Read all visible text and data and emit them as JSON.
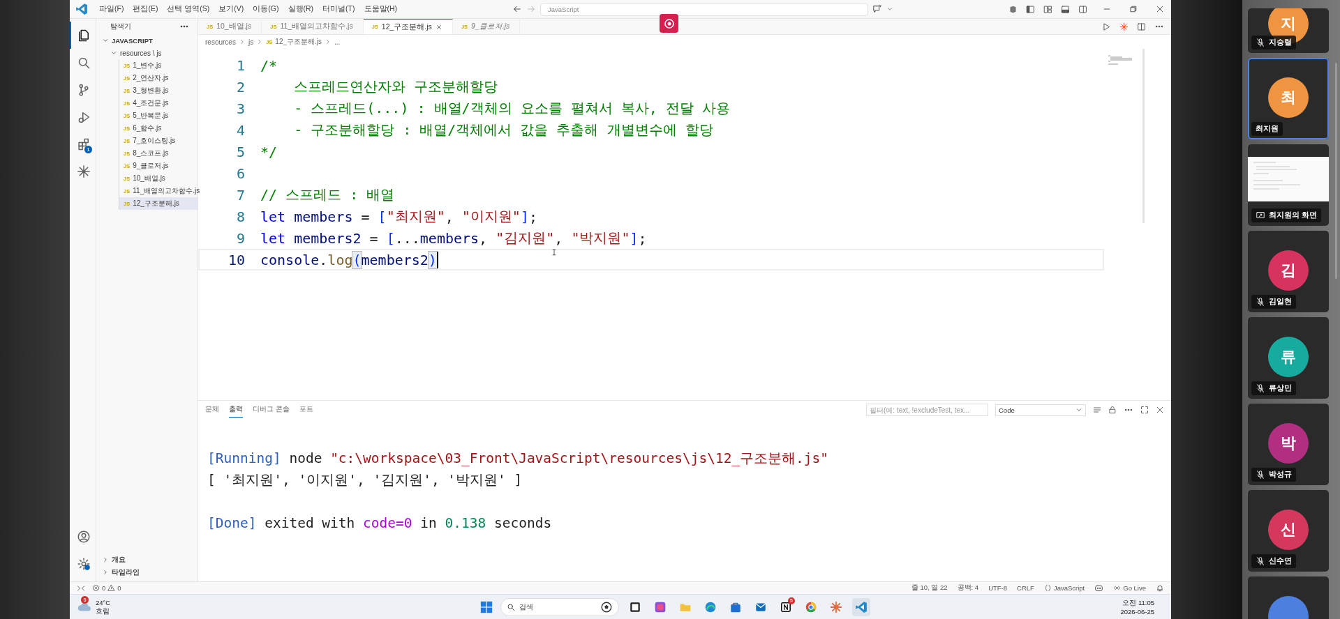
{
  "title_bar": {
    "menu": [
      "파일(F)",
      "편집(E)",
      "선택 영역(S)",
      "보기(V)",
      "이동(G)",
      "실행(R)",
      "터미널(T)",
      "도움말(H)"
    ],
    "search": {
      "value": "JavaScript"
    }
  },
  "activity_bar": {
    "items": [
      {
        "kind": "files",
        "selected": true
      },
      {
        "kind": "search",
        "selected": false
      },
      {
        "kind": "source-control",
        "selected": false
      },
      {
        "kind": "run",
        "selected": false
      },
      {
        "kind": "extensions",
        "selected": false,
        "badge": "1"
      },
      {
        "kind": "spark",
        "selected": false
      }
    ],
    "bottom": [
      {
        "kind": "account"
      },
      {
        "kind": "settings"
      }
    ]
  },
  "sidebar": {
    "title": "탐색기",
    "tree": [
      {
        "label": "JAVASCRIPT",
        "expanded": true,
        "children": [
          {
            "label": "resources \\ js",
            "expanded": true,
            "children": [
              {
                "icon": "JS",
                "label": "1_변수.js",
                "selected": false
              },
              {
                "icon": "JS",
                "label": "2_연산자.js",
                "selected": false
              },
              {
                "icon": "JS",
                "label": "3_형변환.js",
                "selected": false
              },
              {
                "icon": "JS",
                "label": "4_조건문.js",
                "selected": false
              },
              {
                "icon": "JS",
                "label": "5_반복문.js",
                "selected": false
              },
              {
                "icon": "JS",
                "label": "6_함수.js",
                "selected": false
              },
              {
                "icon": "JS",
                "label": "7_호이스팅.js",
                "selected": false
              },
              {
                "icon": "JS",
                "label": "8_스코프.js",
                "selected": false
              },
              {
                "icon": "JS",
                "label": "9_클로저.js",
                "selected": false
              },
              {
                "icon": "JS",
                "label": "10_배열.js",
                "selected": false
              },
              {
                "icon": "JS",
                "label": "11_배열의고차함수.js",
                "selected": false
              },
              {
                "icon": "JS",
                "label": "12_구조분해.js",
                "selected": true
              }
            ]
          }
        ]
      }
    ],
    "sections": [
      {
        "label": "개요",
        "expanded": false
      },
      {
        "label": "타임라인",
        "expanded": false
      }
    ]
  },
  "tabs": [
    {
      "icon": "JS",
      "label": "10_배열.js",
      "selected": false,
      "preview": false
    },
    {
      "icon": "JS",
      "label": "11_배열의고차함수.js",
      "selected": false,
      "preview": false
    },
    {
      "icon": "JS",
      "label": "12_구조분해.js",
      "selected": true,
      "preview": false
    },
    {
      "icon": "JS",
      "label": "9_클로저.js",
      "selected": false,
      "preview": true
    }
  ],
  "breadcrumb": [
    {
      "label": "resources"
    },
    {
      "label": "js"
    },
    {
      "icon": "JS",
      "label": "12_구조분해.js"
    },
    {
      "label": "..."
    }
  ],
  "editor": {
    "lines": [
      {
        "number": "1",
        "current": false,
        "tokens": [
          {
            "kind": "comment",
            "text": "/*"
          }
        ]
      },
      {
        "number": "2",
        "current": false,
        "tokens": [
          {
            "kind": "comment",
            "text": "    스프레드연산자와 구조분해할당"
          }
        ]
      },
      {
        "number": "3",
        "current": false,
        "tokens": [
          {
            "kind": "comment",
            "text": "    - 스프레드(...) : 배열/객체의 요소를 펼쳐서 복사, 전달 사용"
          }
        ]
      },
      {
        "number": "4",
        "current": false,
        "tokens": [
          {
            "kind": "comment",
            "text": "    - 구조분해할당 : 배열/객체에서 값을 추출해 개별변수에 할당"
          }
        ]
      },
      {
        "number": "5",
        "current": false,
        "tokens": [
          {
            "kind": "comment",
            "text": "*/"
          }
        ]
      },
      {
        "number": "6",
        "current": false
      },
      {
        "number": "7",
        "current": false,
        "tokens": [
          {
            "kind": "comment",
            "text": "// 스프레드 : 배열"
          }
        ]
      },
      {
        "number": "8",
        "current": false,
        "tokens": [
          {
            "kind": "keyword",
            "text": "let "
          },
          {
            "kind": "variable",
            "text": "members"
          },
          {
            "kind": "plain",
            "text": " = "
          },
          {
            "kind": "bracket",
            "text": "["
          },
          {
            "kind": "string",
            "text": "\"최지원\""
          },
          {
            "kind": "plain",
            "text": ", "
          },
          {
            "kind": "string",
            "text": "\"이지원\""
          },
          {
            "kind": "bracket",
            "text": "]"
          },
          {
            "kind": "plain",
            "text": ";"
          }
        ]
      },
      {
        "number": "9",
        "current": false,
        "tokens": [
          {
            "kind": "keyword",
            "text": "let "
          },
          {
            "kind": "variable",
            "text": "members2"
          },
          {
            "kind": "plain",
            "text": " = "
          },
          {
            "kind": "bracket",
            "text": "["
          },
          {
            "kind": "plain",
            "text": "..."
          },
          {
            "kind": "variable",
            "text": "members"
          },
          {
            "kind": "plain",
            "text": ", "
          },
          {
            "kind": "string",
            "text": "\"김지원\""
          },
          {
            "kind": "plain",
            "text": ", "
          },
          {
            "kind": "string",
            "text": "\"박지원\""
          },
          {
            "kind": "bracket",
            "text": "]"
          },
          {
            "kind": "plain",
            "text": ";"
          }
        ]
      },
      {
        "number": "10",
        "current": true,
        "tokens": [
          {
            "kind": "variable",
            "text": "console"
          },
          {
            "kind": "plain",
            "text": "."
          },
          {
            "kind": "func",
            "text": "log"
          },
          {
            "kind": "match",
            "text": "("
          },
          {
            "kind": "variable",
            "text": "members2"
          },
          {
            "kind": "match",
            "text": ")"
          }
        ]
      }
    ]
  },
  "panel": {
    "tabs": [
      {
        "label": "문제",
        "selected": false
      },
      {
        "label": "출력",
        "selected": true
      },
      {
        "label": "디버그 콘솔",
        "selected": false
      },
      {
        "label": "포트",
        "selected": false
      }
    ],
    "filter": {
      "placeholder": "필터(예: text, !excludeTest, tex..."
    },
    "channel": "Code",
    "output": [
      {
        "lines": [
          {
            "tokens": [
              {
                "kind": "tag",
                "text": "[Running]"
              },
              {
                "kind": "plain",
                "text": " node "
              },
              {
                "kind": "string",
                "text": "\"c:\\workspace\\03_Front\\JavaScript\\resources\\js\\12_구조분해.js\""
              }
            ]
          },
          {
            "tokens": [
              {
                "kind": "plain",
                "text": "[ '최지원', '이지원', '김지원', '박지원' ]"
              }
            ]
          }
        ]
      },
      {
        "lines": [
          {
            "tokens": [
              {
                "kind": "tag",
                "text": "[Done]"
              },
              {
                "kind": "plain",
                "text": " exited with "
              },
              {
                "kind": "param",
                "text": "code=0"
              },
              {
                "kind": "plain",
                "text": " in "
              },
              {
                "kind": "number",
                "text": "0.138"
              },
              {
                "kind": "plain",
                "text": " seconds"
              }
            ]
          }
        ]
      }
    ]
  },
  "status_bar": {
    "errors": "0",
    "warnings": "0",
    "items": [
      {
        "kind": "text",
        "text": "줄 10, 열 22"
      },
      {
        "kind": "text",
        "text": "공백: 4"
      },
      {
        "kind": "text",
        "text": "UTF-8"
      },
      {
        "kind": "text",
        "text": "CRLF"
      },
      {
        "kind": "language",
        "text": "JavaScript"
      },
      {
        "kind": "feedback"
      },
      {
        "kind": "live",
        "text": "Go Live"
      },
      {
        "kind": "bell"
      }
    ]
  },
  "taskbar": {
    "weather": {
      "temp": "24°C",
      "condition": "흐림",
      "badge": "6"
    },
    "search": {
      "placeholder": "검색"
    },
    "apps": [
      {
        "kind": "taskview"
      },
      {
        "kind": "suite"
      },
      {
        "kind": "folder"
      },
      {
        "kind": "browser"
      },
      {
        "kind": "store"
      },
      {
        "kind": "mail"
      },
      {
        "kind": "notes",
        "badge": "5"
      },
      {
        "kind": "chrome"
      },
      {
        "kind": "spark"
      },
      {
        "kind": "code"
      }
    ],
    "time": "오전 11:05",
    "date": "2026-06-25"
  },
  "participants": [
    {
      "kind": "avatar",
      "initial": "지",
      "name": "지승렬",
      "color": "#ef9440",
      "muted": true,
      "selected": false
    },
    {
      "kind": "avatar",
      "initial": "최",
      "name": "최지원",
      "color": "#ef9440",
      "muted": false,
      "selected": true
    },
    {
      "kind": "screen",
      "name": "최지원의 화면",
      "selected": false
    },
    {
      "kind": "avatar",
      "initial": "김",
      "name": "김일현",
      "color": "#d8335f",
      "muted": true,
      "selected": false
    },
    {
      "kind": "avatar",
      "initial": "류",
      "name": "류상민",
      "color": "#17aba0",
      "muted": true,
      "selected": false
    },
    {
      "kind": "avatar",
      "initial": "박",
      "name": "박성규",
      "color": "#b12e80",
      "muted": true,
      "selected": false
    },
    {
      "kind": "avatar",
      "initial": "신",
      "name": "신수연",
      "color": "#d5385d",
      "muted": true,
      "selected": false
    },
    {
      "kind": "avatar",
      "color": "#4d7fe0",
      "selected": false
    }
  ]
}
